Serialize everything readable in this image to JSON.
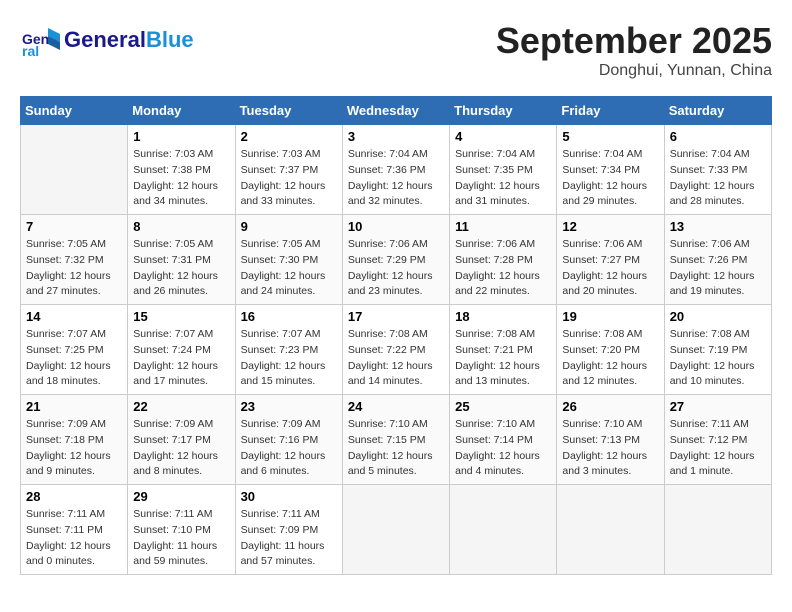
{
  "header": {
    "logo_general": "General",
    "logo_blue": "Blue",
    "month_title": "September 2025",
    "location": "Donghui, Yunnan, China"
  },
  "calendar": {
    "days_of_week": [
      "Sunday",
      "Monday",
      "Tuesday",
      "Wednesday",
      "Thursday",
      "Friday",
      "Saturday"
    ],
    "weeks": [
      [
        {
          "day": "",
          "info": ""
        },
        {
          "day": "1",
          "info": "Sunrise: 7:03 AM\nSunset: 7:38 PM\nDaylight: 12 hours\nand 34 minutes."
        },
        {
          "day": "2",
          "info": "Sunrise: 7:03 AM\nSunset: 7:37 PM\nDaylight: 12 hours\nand 33 minutes."
        },
        {
          "day": "3",
          "info": "Sunrise: 7:04 AM\nSunset: 7:36 PM\nDaylight: 12 hours\nand 32 minutes."
        },
        {
          "day": "4",
          "info": "Sunrise: 7:04 AM\nSunset: 7:35 PM\nDaylight: 12 hours\nand 31 minutes."
        },
        {
          "day": "5",
          "info": "Sunrise: 7:04 AM\nSunset: 7:34 PM\nDaylight: 12 hours\nand 29 minutes."
        },
        {
          "day": "6",
          "info": "Sunrise: 7:04 AM\nSunset: 7:33 PM\nDaylight: 12 hours\nand 28 minutes."
        }
      ],
      [
        {
          "day": "7",
          "info": "Sunrise: 7:05 AM\nSunset: 7:32 PM\nDaylight: 12 hours\nand 27 minutes."
        },
        {
          "day": "8",
          "info": "Sunrise: 7:05 AM\nSunset: 7:31 PM\nDaylight: 12 hours\nand 26 minutes."
        },
        {
          "day": "9",
          "info": "Sunrise: 7:05 AM\nSunset: 7:30 PM\nDaylight: 12 hours\nand 24 minutes."
        },
        {
          "day": "10",
          "info": "Sunrise: 7:06 AM\nSunset: 7:29 PM\nDaylight: 12 hours\nand 23 minutes."
        },
        {
          "day": "11",
          "info": "Sunrise: 7:06 AM\nSunset: 7:28 PM\nDaylight: 12 hours\nand 22 minutes."
        },
        {
          "day": "12",
          "info": "Sunrise: 7:06 AM\nSunset: 7:27 PM\nDaylight: 12 hours\nand 20 minutes."
        },
        {
          "day": "13",
          "info": "Sunrise: 7:06 AM\nSunset: 7:26 PM\nDaylight: 12 hours\nand 19 minutes."
        }
      ],
      [
        {
          "day": "14",
          "info": "Sunrise: 7:07 AM\nSunset: 7:25 PM\nDaylight: 12 hours\nand 18 minutes."
        },
        {
          "day": "15",
          "info": "Sunrise: 7:07 AM\nSunset: 7:24 PM\nDaylight: 12 hours\nand 17 minutes."
        },
        {
          "day": "16",
          "info": "Sunrise: 7:07 AM\nSunset: 7:23 PM\nDaylight: 12 hours\nand 15 minutes."
        },
        {
          "day": "17",
          "info": "Sunrise: 7:08 AM\nSunset: 7:22 PM\nDaylight: 12 hours\nand 14 minutes."
        },
        {
          "day": "18",
          "info": "Sunrise: 7:08 AM\nSunset: 7:21 PM\nDaylight: 12 hours\nand 13 minutes."
        },
        {
          "day": "19",
          "info": "Sunrise: 7:08 AM\nSunset: 7:20 PM\nDaylight: 12 hours\nand 12 minutes."
        },
        {
          "day": "20",
          "info": "Sunrise: 7:08 AM\nSunset: 7:19 PM\nDaylight: 12 hours\nand 10 minutes."
        }
      ],
      [
        {
          "day": "21",
          "info": "Sunrise: 7:09 AM\nSunset: 7:18 PM\nDaylight: 12 hours\nand 9 minutes."
        },
        {
          "day": "22",
          "info": "Sunrise: 7:09 AM\nSunset: 7:17 PM\nDaylight: 12 hours\nand 8 minutes."
        },
        {
          "day": "23",
          "info": "Sunrise: 7:09 AM\nSunset: 7:16 PM\nDaylight: 12 hours\nand 6 minutes."
        },
        {
          "day": "24",
          "info": "Sunrise: 7:10 AM\nSunset: 7:15 PM\nDaylight: 12 hours\nand 5 minutes."
        },
        {
          "day": "25",
          "info": "Sunrise: 7:10 AM\nSunset: 7:14 PM\nDaylight: 12 hours\nand 4 minutes."
        },
        {
          "day": "26",
          "info": "Sunrise: 7:10 AM\nSunset: 7:13 PM\nDaylight: 12 hours\nand 3 minutes."
        },
        {
          "day": "27",
          "info": "Sunrise: 7:11 AM\nSunset: 7:12 PM\nDaylight: 12 hours\nand 1 minute."
        }
      ],
      [
        {
          "day": "28",
          "info": "Sunrise: 7:11 AM\nSunset: 7:11 PM\nDaylight: 12 hours\nand 0 minutes."
        },
        {
          "day": "29",
          "info": "Sunrise: 7:11 AM\nSunset: 7:10 PM\nDaylight: 11 hours\nand 59 minutes."
        },
        {
          "day": "30",
          "info": "Sunrise: 7:11 AM\nSunset: 7:09 PM\nDaylight: 11 hours\nand 57 minutes."
        },
        {
          "day": "",
          "info": ""
        },
        {
          "day": "",
          "info": ""
        },
        {
          "day": "",
          "info": ""
        },
        {
          "day": "",
          "info": ""
        }
      ]
    ]
  }
}
